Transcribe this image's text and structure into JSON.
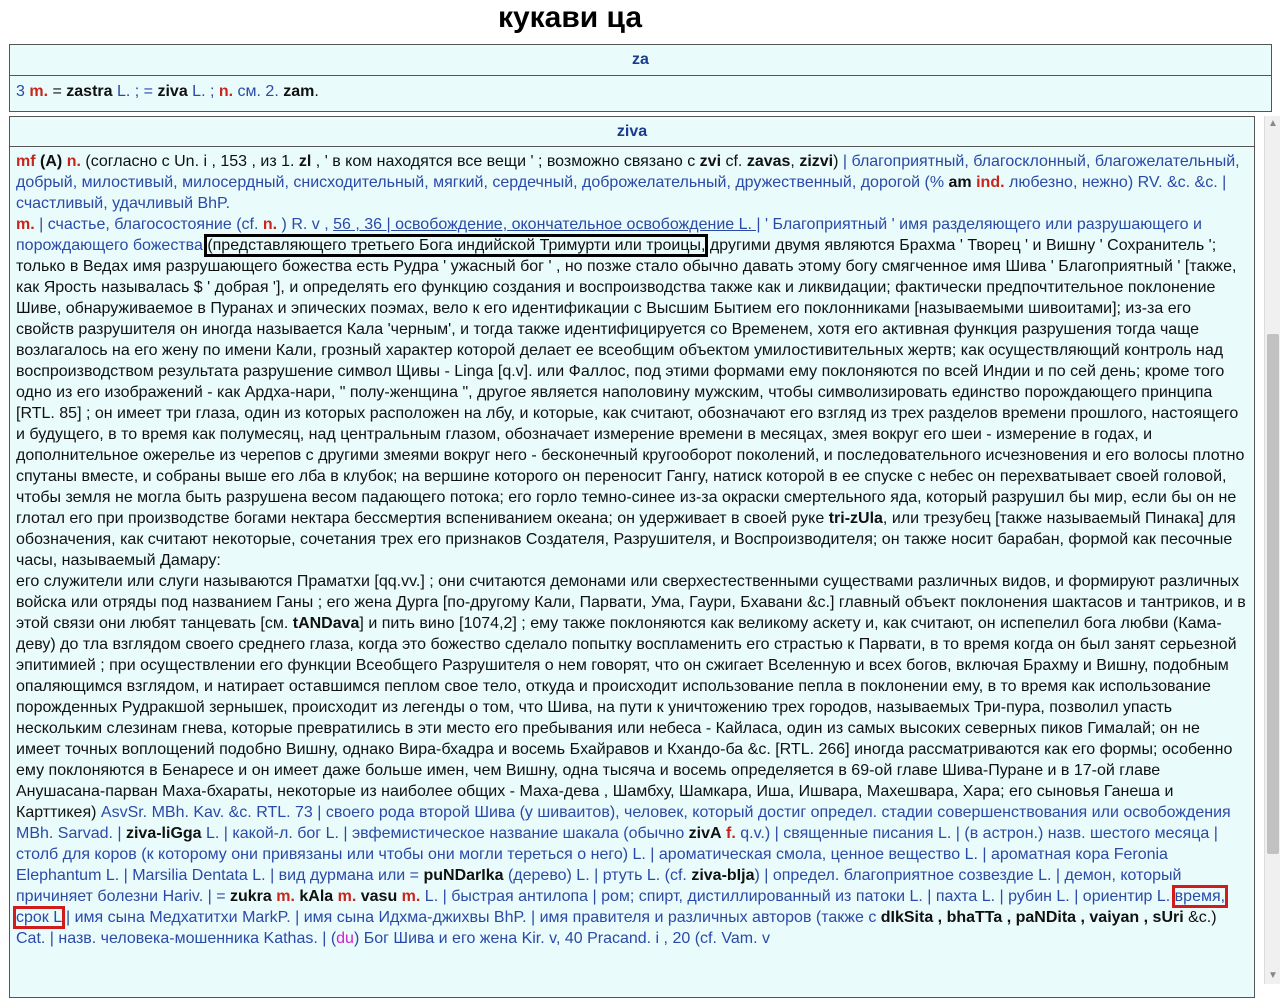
{
  "page_title": "кукави  ца",
  "entry_za": {
    "headword": "za",
    "body": {
      "num": "3",
      "m1": "m.",
      "eq1": "=",
      "w1": "zastra",
      "l1": "L. ; =",
      "w2": "ziva",
      "l2": "L. ;",
      "n1": "n.",
      "rest": "см. 2.",
      "w3": "zam",
      "end": "."
    }
  },
  "entry_ziva": {
    "headword": "ziva",
    "p1": {
      "mf": "mf",
      "A": "(A)",
      "n": "n.",
      "t1": "(согласно с Un. i , 153 , из 1.",
      "zl": "zl",
      "t2": ", ' в ком находятся все вещи ' ; возможно связано с",
      "zvi": "zvi",
      "t3": "cf.",
      "zavas": "zavas",
      "t4": ",",
      "zizvi": "zizvi",
      "t5": ")",
      "t6": "| благоприятный, благосклонный, благожелательный, добрый, милостивый, милосердный, снисходительный, мягкий, сердечный, доброжелательный, дружественный, дорогой (%",
      "am": "am",
      "ind": "ind.",
      "t7": "любезно, нежно)",
      "t8": "RV. &c. &c. | счастливый, удачливый BhP."
    },
    "p2": {
      "m": "m.",
      "t1": "| счастье, благосостояние (cf.",
      "n": "n.",
      "t2": ") R. v ,",
      "link": "56 , 36 | освобождение, окончательное освобождение L. |",
      "t3": "' Благоприятный ' имя разделяющего или разрушающего и порождающего божества",
      "boxed": "(представляющего третьего Бога индийской Тримурти или троицы,",
      "t4": "другими двумя являются Брахма ' Творец ' и Вишну ' Сохранитель '; только в Ведах имя разрушающего божества есть Рудра ' ужасный бог ' , но позже стало обычно давать этому богу смягченное имя Шива ' Благоприятный ' [также, как Ярость называлась $ ' добрая '], и определять его функцию создания и воспроизводства также как и ликвидации; фактически предпочтительное поклонение Шиве, обнаруживаемое в Пуранах и эпических поэмах, вело к его идентификации с Высшим Бытием его поклонниками [называемыми шивоитами]; из-за его свойств разрушителя он иногда называется Кала 'черным', и тогда также идентифицируется со Временем, хотя его активная функция разрушения тогда чаще возлагалось на его жену по имени Кали, грозный характер которой делает ее всеобщим объектом умилостивительных жертв; как осуществляющий контроль над воспроизводством результата разрушение символ Щивы - Linga [q.v]. или Фаллос, под этими формами ему поклоняются по всей Индии и по сей день; кроме того одно из его изображений - как Ардха-нари, \" полу-женщина \", другое является наполовину мужским, чтобы символизировать единство порождающего принципа [RTL. 85] ; он имеет три глаза, один из которых расположен на лбу, и которые, как считают, обозначают его взгляд из трех разделов времени прошлого, настоящего и будущего, в то время как полумесяц, над центральным глазом, обозначает измерение времени в месяцах, змея вокруг его шеи - измерение в годах, и дополнительное ожерелье из черепов с другими змеями вокруг него - бесконечный кругооборот поколений, и последовательного исчезновения и его волосы плотно спутаны вместе, и собраны выше его лба в клубок; на вершине которого он переносит Гангу, натиск которой в ее спуске с небес он перехватывает своей головой, чтобы земля не могла быть разрушена весом падающего потока; его горло темно-синее из-за окраски смертельного яда, который разрушил бы мир, если бы он не глотал его при производстве богами нектара бессмертия вспениванием океана; он удерживает в своей руке",
      "trizula": "tri-zUla",
      "t5": ", или трезубец [также называемый Пинака] для обозначения, как считают некоторые, сочетания трех его признаков Создателя, Разрушителя, и Воспроизводителя; он также носит барабан, формой как песочные часы, называемый Дамару:",
      "t6": "его служители или слуги называются Праматхи [qq.vv.] ; они считаются демонами или сверхестественными существами различных видов, и формируют различных войска или отряды под названием Ганы ; его жена Дурга [по-другому Кали, Парвати, Ума, Гаури, Бхавани &c.] главный объект поклонения шактасов и тантриков, и в этой связи они любят танцевать [см.",
      "tandava": "tANDava",
      "t7": "] и пить вино [1074,2] ; ему также поклоняются как великому аскету и, как считают, он испепелил бога любви (Кама-деву) до тла взглядом своего среднего глаза, когда это божество сделало попытку воспламенить его страстью к Парвати, в то время когда он был занят серьезной эпитимией ; при осуществлении его функции Всеобщего Разрушителя о нем говорят, что он сжигает Вселенную и всех богов, включая Брахму и Вишну, подобным опаляющимся взглядом, и натирает оставшимся пеплом свое тело, откуда и происходит использование пепла в поклонении ему, в то время как использование порожденных Рудракшой зернышек, происходит из легенды о том, что Шива, на пути к уничтожению трех городов, называемых Три-пура, позволил упасть нескольким слезинам гнева, которые превратились в эти место его пребывания или небеса - Кайласа, один из самых высоких северных пиков Гималай; он не имеет точных воплощений подобно Вишну, однако Вира-бхадра и восемь Бхайравов и Кхандо-ба &c. [RTL. 266] иногда рассматриваются как его формы; особенно ему поклоняются в Бенаресе и он имеет даже больше имен, чем Вишну, одна тысяча и восемь определяется в 69-ой главе Шива-Пуране и в 17-ой главе Анушасана-парван Маха-бхараты, некоторые из наиболее общих - Маха-дева , Шамбху, Шамкара, Иша, Ишвара, Махешвара, Хара; его сыновья Ганеша и Карттикея)",
      "t8": "AsvSr. MBh. Kav. &c. RTL. 73 | своего рода второй Шива (у шиваитов), человек, который достиг определ. стадии совершенствования или освобождения MBh. Sarvad. |",
      "zivalinga": "ziva-liGga",
      "t9": "L. | какой-л. бог L. | эвфемистическое название шакала (обычно",
      "zivA": "zivA",
      "f": "f.",
      "t10": "q.v.) | священные писания L. | (в астрон.) назв. шестого месяца | столб для коров (к которому они привязаны или чтобы они могли тереться о него) L. | ароматическая смола, ценное вещество L. | ароматная кора Feronia Elephantum L. | Marsilia Dentata L. | вид дурмана или =",
      "pundarika": "puNDarIka",
      "t11": "(дерево) L. | ртуть L. (cf.",
      "zivabija": "ziva-bIja",
      "t12": ") | определ. благоприятное созвездие L. | демон, который причиняет болезни Hariv. | =",
      "zukra": "zukra",
      "m2": "m.",
      "kAla": "kAla",
      "m3": "m.",
      "vasu": "vasu",
      "m4": "m.",
      "t13": "L. | быстрая антилопа | ром; спирт, дистиллированный из патоки L. | пахта L. | рубин L. | ориентир L.",
      "boxed_red": "время, срок L",
      "t14": "| имя сына Медхатитхи MarkP. | имя сына Идхма-джихвы BhP. | имя правителя и различных авторов (также с",
      "tail_b": "dIkSita , bhaTTa , paNDita , vaiyan , sUri",
      "t15": "&c.)",
      "t16": "Cat. | назв. человека-мошенника Kathas. | (",
      "du": "du",
      "t17": ") Бог Шива и его жена Kir. v, 40 Pracand. i , 20 (cf. Vam. v"
    }
  }
}
